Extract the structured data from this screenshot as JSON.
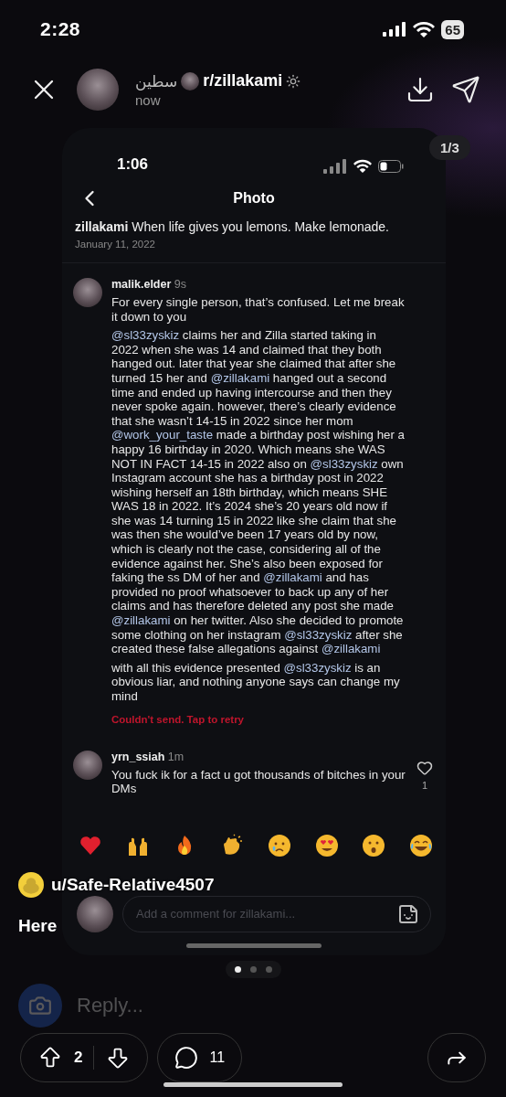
{
  "status_bar": {
    "time": "2:28",
    "battery": "65"
  },
  "header": {
    "ghost_title": "سطين",
    "subreddit": "r/zillakami",
    "time": "now"
  },
  "counter": "1/3",
  "screenshot": {
    "status_bar": {
      "time": "1:06"
    },
    "title": "Photo",
    "caption": {
      "user": "zillakami",
      "text": "When life gives you lemons. Make lemonade.",
      "date": "January 11, 2022"
    },
    "comments": [
      {
        "user": "malik.elder",
        "time": "9s",
        "paragraphs": [
          [
            {
              "text": "For every single person, that’s confused. Let me break it down to you",
              "mention": false
            }
          ],
          [
            {
              "text": "@sl33zyskiz",
              "mention": true
            },
            {
              "text": " claims her and Zilla started taking in 2022 when she was 14 and claimed that they both hanged out. later that year she claimed that after she turned 15 her and ",
              "mention": false
            },
            {
              "text": "@zillakami",
              "mention": true
            },
            {
              "text": " hanged out a second time and ended up having intercourse and then they never spoke again. however, there’s clearly evidence that she wasn’t 14-15 in 2022 since her mom ",
              "mention": false
            },
            {
              "text": "@work_your_taste",
              "mention": true
            },
            {
              "text": " made a birthday post wishing her a happy 16 birthday in 2020. Which means she WAS NOT IN FACT 14-15 in 2022 also on ",
              "mention": false
            },
            {
              "text": "@sl33zyskiz",
              "mention": true
            },
            {
              "text": " own Instagram account she has a birthday post in 2022 wishing herself an 18th birthday, which means SHE WAS 18 in 2022. It’s 2024 she’s 20 years old now if she was 14 turning 15 in 2022 like she claim that she was then she would’ve been 17 years old by now, which is clearly not the case, considering all of the evidence against her. She’s also been exposed for faking the ss DM of her and ",
              "mention": false
            },
            {
              "text": "@zillakami",
              "mention": true
            },
            {
              "text": " and has provided no proof whatsoever to back up any of her claims and has therefore deleted any post she made ",
              "mention": false
            },
            {
              "text": "@zillakami",
              "mention": true
            },
            {
              "text": " on her twitter. Also she decided to promote some clothing on her instagram ",
              "mention": false
            },
            {
              "text": "@sl33zyskiz",
              "mention": true
            },
            {
              "text": " after she created these false allegations against ",
              "mention": false
            },
            {
              "text": "@zillakami",
              "mention": true
            }
          ],
          [
            {
              "text": "with all this evidence presented ",
              "mention": false
            },
            {
              "text": "@sl33zyskiz",
              "mention": true
            },
            {
              "text": " is an obvious liar, and nothing anyone says can change my mind",
              "mention": false
            }
          ]
        ],
        "error": "Couldn't send. Tap to retry"
      },
      {
        "user": "yrn_ssiah",
        "time": "1m",
        "paragraphs": [
          [
            {
              "text": "You fuck ik for a fact u got thousands of bitches in your DMs",
              "mention": false
            }
          ]
        ],
        "likes": "1"
      }
    ],
    "comment_input": {
      "placeholder": "Add a comment for zillakami..."
    }
  },
  "post": {
    "author": "u/Safe-Relative4507",
    "body": "Here"
  },
  "pages": [
    {
      "selected": true
    },
    {
      "selected": false
    },
    {
      "selected": false
    }
  ],
  "reply": {
    "placeholder": "Reply..."
  },
  "actions": {
    "score": "2",
    "comments": "11"
  }
}
